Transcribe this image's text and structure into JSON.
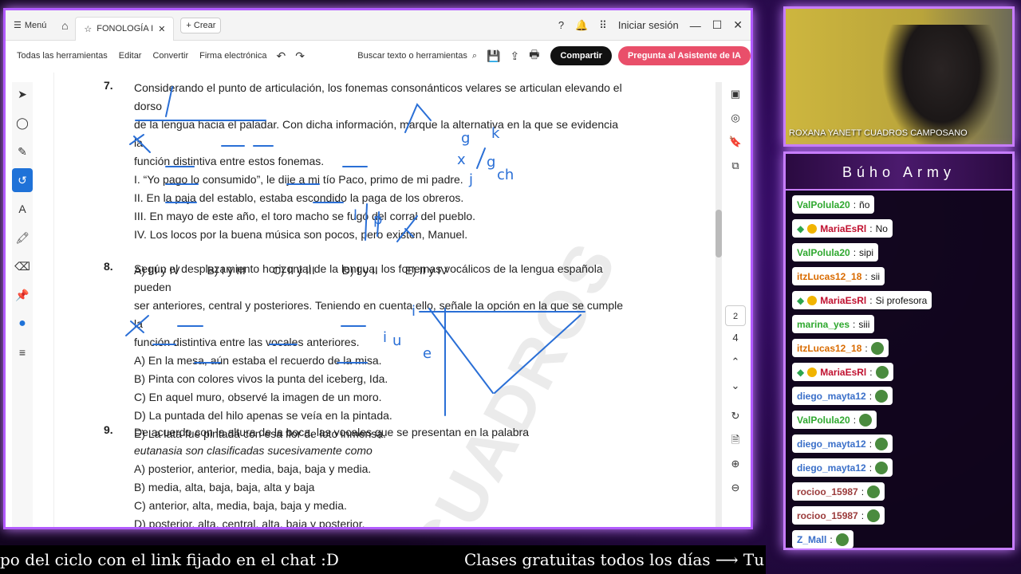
{
  "viewer": {
    "topbar": {
      "menu_label": "Menú",
      "tab_title": "FONOLOGÍA I",
      "create_label": "+ Crear",
      "signin_label": "Iniciar sesión"
    },
    "toolbar": {
      "all_tools": "Todas las herramientas",
      "edit": "Editar",
      "convert": "Convertir",
      "esign": "Firma electrónica",
      "search_placeholder": "Buscar texto o herramientas",
      "share": "Compartir",
      "ai": "Pregunta al Asistente de IA"
    },
    "page_numbers": [
      "2",
      "4"
    ],
    "watermark": "CUADROS"
  },
  "questions": [
    {
      "num": "7.",
      "text_lines": [
        "Considerando el punto de articulación, los fonemas consonánticos velares se articulan elevando el dorso",
        "de la lengua hacia el paladar. Con dicha información, marque la alternativa en la que se evidencia la",
        "función distintiva entre estos fonemas."
      ],
      "items": [
        "I. “Yo pago lo consumido”, le dije a mi tío Paco, primo de mi padre.",
        "II. En la paja del establo, estaba escondido la paga de los obreros.",
        "III. En mayo de este año, el toro macho se fugó del corral del pueblo.",
        "IV. Los locos por la buena música son pocos, pero existen, Manuel."
      ],
      "answers": [
        "A) III y IV",
        "B) I y III",
        "C) II y III",
        "D) I y II",
        "E) II y IV"
      ]
    },
    {
      "num": "8.",
      "text_lines": [
        "Según el desplazamiento horizontal de la lengua, los fonemas vocálicos de la lengua española pueden",
        "ser anteriores, central y posteriores. Teniendo en cuenta ello, señale la opción en la que se cumple la",
        "función distintiva entre las vocales anteriores."
      ],
      "options": [
        "A)  En la mesa, aún estaba el recuerdo de la misa.",
        "B)  Pinta con colores vivos la punta del iceberg, Ida.",
        "C)  En aquel muro, observé la imagen de un moro.",
        "D)  La puntada del hilo apenas se veía en la pintada.",
        "E)  La lata fue pintada con esa flor de loto inmensa."
      ]
    },
    {
      "num": "9.",
      "text_lines": [
        "De acuerdo con la altura de la boca, las vocales que se presentan en la palabra",
        "eutanasia son clasificadas sucesivamente como"
      ],
      "options": [
        "A)  posterior, anterior, media, baja, baja y media.",
        "B)  media, alta, baja, baja, alta y baja",
        "C)  anterior, alta, media, baja, baja y media.",
        "D)  posterior, alta, central, alta, baja y posterior."
      ]
    }
  ],
  "ink_annotations": [
    "g",
    "k",
    "x",
    "g",
    "j",
    "ch",
    "l",
    "p",
    "i",
    "e",
    "i",
    "u"
  ],
  "webcam": {
    "name": "ROXANA YANETT CUADROS CAMPOSANO"
  },
  "chat": {
    "title": "Búho Army",
    "messages": [
      {
        "user": "ValPolula20",
        "text": "ño",
        "user_color": "#2fa82f",
        "badges": false,
        "emoji": false
      },
      {
        "user": "MariaEsRl",
        "text": "No",
        "user_color": "#c0102f",
        "badges": true,
        "emoji": false
      },
      {
        "user": "ValPolula20",
        "text": "sipi",
        "user_color": "#2fa82f",
        "badges": false,
        "emoji": false
      },
      {
        "user": "itzLucas12_18",
        "text": "sii",
        "user_color": "#d96b00",
        "badges": false,
        "emoji": false
      },
      {
        "user": "MariaEsRl",
        "text": "Si profesora",
        "user_color": "#c0102f",
        "badges": true,
        "emoji": false
      },
      {
        "user": "marina_yes",
        "text": "siii",
        "user_color": "#2fa82f",
        "badges": false,
        "emoji": false
      },
      {
        "user": "itzLucas12_18",
        "text": "",
        "user_color": "#d96b00",
        "badges": false,
        "emoji": true
      },
      {
        "user": "MariaEsRl",
        "text": "",
        "user_color": "#c0102f",
        "badges": true,
        "emoji": true
      },
      {
        "user": "diego_mayta12",
        "text": "",
        "user_color": "#3a6fc9",
        "badges": false,
        "emoji": true
      },
      {
        "user": "ValPolula20",
        "text": "",
        "user_color": "#2fa82f",
        "badges": false,
        "emoji": true
      },
      {
        "user": "diego_mayta12",
        "text": "",
        "user_color": "#3a6fc9",
        "badges": false,
        "emoji": true
      },
      {
        "user": "diego_mayta12",
        "text": "",
        "user_color": "#3a6fc9",
        "badges": false,
        "emoji": true
      },
      {
        "user": "rocioo_15987",
        "text": "",
        "user_color": "#9b3b3b",
        "badges": false,
        "emoji": true
      },
      {
        "user": "rocioo_15987",
        "text": "",
        "user_color": "#9b3b3b",
        "badges": false,
        "emoji": true
      },
      {
        "user": "Z_Mall",
        "text": "",
        "user_color": "#3a6fc9",
        "badges": false,
        "emoji": true
      }
    ]
  },
  "ticker": {
    "left": "po del ciclo con el link fijado en el chat :D",
    "right": "Clases gratuitas todos los días  ⟶  Tu"
  }
}
